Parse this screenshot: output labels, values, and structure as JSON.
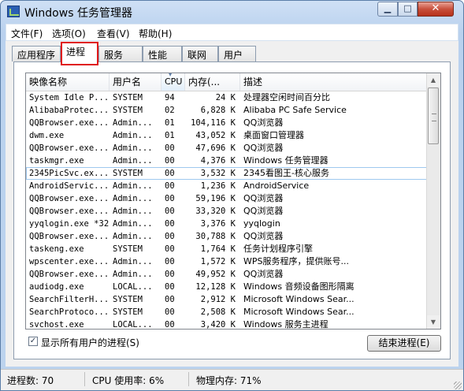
{
  "window": {
    "title": "Windows 任务管理器",
    "minimize": "▁",
    "maximize": "□",
    "close": "✕"
  },
  "menu": [
    "文件(F)",
    "选项(O)",
    "查看(V)",
    "帮助(H)"
  ],
  "tabs": [
    "应用程序",
    "进程",
    "服务",
    "性能",
    "联网",
    "用户"
  ],
  "active_tab": "进程",
  "columns": [
    "映像名称",
    "用户名",
    "CPU",
    "内存(...",
    "描述"
  ],
  "processes": [
    {
      "name": "System Idle P...",
      "user": "SYSTEM",
      "cpu": "94",
      "mem": "24 K",
      "desc": "处理器空闲时间百分比"
    },
    {
      "name": "AlibabaProtec...",
      "user": "SYSTEM",
      "cpu": "02",
      "mem": "6,828 K",
      "desc": "Alibaba PC Safe Service"
    },
    {
      "name": "QQBrowser.exe...",
      "user": "Admin...",
      "cpu": "01",
      "mem": "104,116 K",
      "desc": "QQ浏览器"
    },
    {
      "name": "dwm.exe",
      "user": "Admin...",
      "cpu": "01",
      "mem": "43,052 K",
      "desc": "桌面窗口管理器"
    },
    {
      "name": "QQBrowser.exe...",
      "user": "Admin...",
      "cpu": "00",
      "mem": "47,696 K",
      "desc": "QQ浏览器"
    },
    {
      "name": "taskmgr.exe",
      "user": "Admin...",
      "cpu": "00",
      "mem": "4,376 K",
      "desc": "Windows 任务管理器"
    },
    {
      "name": "2345PicSvc.ex...",
      "user": "SYSTEM",
      "cpu": "00",
      "mem": "3,532 K",
      "desc": "2345看图王-核心服务"
    },
    {
      "name": "AndroidServic...",
      "user": "Admin...",
      "cpu": "00",
      "mem": "1,236 K",
      "desc": "AndroidService"
    },
    {
      "name": "QQBrowser.exe...",
      "user": "Admin...",
      "cpu": "00",
      "mem": "59,196 K",
      "desc": "QQ浏览器"
    },
    {
      "name": "QQBrowser.exe...",
      "user": "Admin...",
      "cpu": "00",
      "mem": "33,320 K",
      "desc": "QQ浏览器"
    },
    {
      "name": "yyqlogin.exe *32",
      "user": "Admin...",
      "cpu": "00",
      "mem": "3,376 K",
      "desc": "yyqlogin"
    },
    {
      "name": "QQBrowser.exe...",
      "user": "Admin...",
      "cpu": "00",
      "mem": "30,788 K",
      "desc": "QQ浏览器"
    },
    {
      "name": "taskeng.exe",
      "user": "SYSTEM",
      "cpu": "00",
      "mem": "1,764 K",
      "desc": "任务计划程序引擎"
    },
    {
      "name": "wpscenter.exe...",
      "user": "Admin...",
      "cpu": "00",
      "mem": "1,572 K",
      "desc": "WPS服务程序，提供账号..."
    },
    {
      "name": "QQBrowser.exe...",
      "user": "Admin...",
      "cpu": "00",
      "mem": "49,952 K",
      "desc": "QQ浏览器"
    },
    {
      "name": "audiodg.exe",
      "user": "LOCAL...",
      "cpu": "00",
      "mem": "12,128 K",
      "desc": "Windows 音频设备图形隔离"
    },
    {
      "name": "SearchFilterH...",
      "user": "SYSTEM",
      "cpu": "00",
      "mem": "2,912 K",
      "desc": "Microsoft Windows Sear..."
    },
    {
      "name": "SearchProtoco...",
      "user": "SYSTEM",
      "cpu": "00",
      "mem": "2,508 K",
      "desc": "Microsoft Windows Sear..."
    },
    {
      "name": "svchost.exe",
      "user": "LOCAL...",
      "cpu": "00",
      "mem": "3,420 K",
      "desc": "Windows 服务主进程"
    }
  ],
  "selected_row": 6,
  "show_all_label": "显示所有用户的进程(S)",
  "show_all_checked": true,
  "end_process_label": "结束进程(E)",
  "status": {
    "processes": "进程数: 70",
    "cpu": "CPU 使用率: 6%",
    "memory": "物理内存: 71%"
  },
  "colors": {
    "highlight": "#e0191a",
    "selection_border": "#9ec8ef"
  }
}
